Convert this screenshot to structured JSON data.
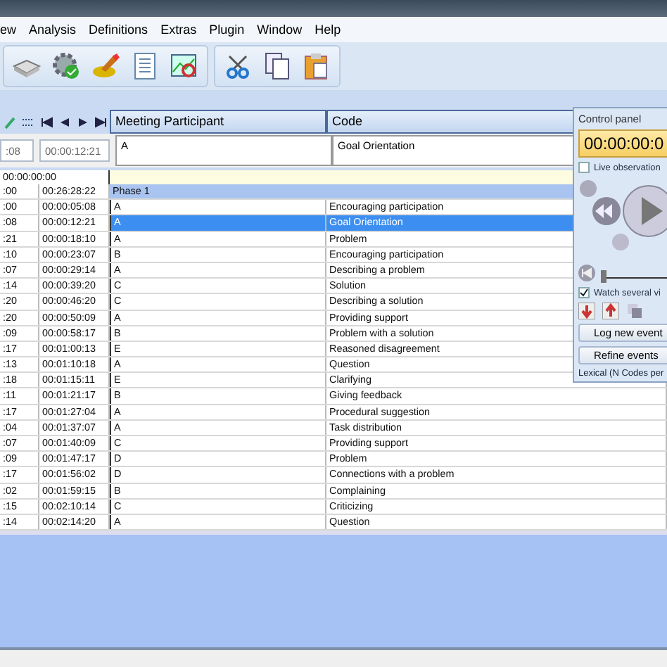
{
  "menu": [
    {
      "label": "ew"
    },
    {
      "label": "Analysis"
    },
    {
      "label": "Definitions"
    },
    {
      "label": "Extras"
    },
    {
      "label": "Plugin"
    },
    {
      "label": "Window"
    },
    {
      "label": "Help"
    }
  ],
  "columns": [
    "Meeting Participant",
    "Code"
  ],
  "editor": {
    "start": ":08",
    "end": "00:00:12:21",
    "participant": "A",
    "code": "Goal Orientation"
  },
  "filter_row": {
    "time": "00:00:00:00"
  },
  "phase": {
    "start": ":00",
    "end": "00:26:28:22",
    "label": "Phase 1"
  },
  "rows": [
    {
      "start": ":00",
      "end": "00:00:05:08",
      "participant": "A",
      "code": "Encouraging participation",
      "selected": false
    },
    {
      "start": ":08",
      "end": "00:00:12:21",
      "participant": "A",
      "code": "Goal Orientation",
      "selected": true
    },
    {
      "start": ":21",
      "end": "00:00:18:10",
      "participant": "A",
      "code": "Problem",
      "selected": false
    },
    {
      "start": ":10",
      "end": "00:00:23:07",
      "participant": "B",
      "code": "Encouraging participation",
      "selected": false
    },
    {
      "start": ":07",
      "end": "00:00:29:14",
      "participant": "A",
      "code": "Describing a problem",
      "selected": false
    },
    {
      "start": ":14",
      "end": "00:00:39:20",
      "participant": "C",
      "code": "Solution",
      "selected": false
    },
    {
      "start": ":20",
      "end": "00:00:46:20",
      "participant": "C",
      "code": "Describing a solution",
      "selected": false
    },
    {
      "start": ":20",
      "end": "00:00:50:09",
      "participant": "A",
      "code": "Providing support",
      "selected": false
    },
    {
      "start": ":09",
      "end": "00:00:58:17",
      "participant": "B",
      "code": "Problem with a solution",
      "selected": false
    },
    {
      "start": ":17",
      "end": "00:01:00:13",
      "participant": "E",
      "code": "Reasoned disagreement",
      "selected": false
    },
    {
      "start": ":13",
      "end": "00:01:10:18",
      "participant": "A",
      "code": "Question",
      "selected": false
    },
    {
      "start": ":18",
      "end": "00:01:15:11",
      "participant": "E",
      "code": "Clarifying",
      "selected": false
    },
    {
      "start": ":11",
      "end": "00:01:21:17",
      "participant": "B",
      "code": "Giving feedback",
      "selected": false
    },
    {
      "start": ":17",
      "end": "00:01:27:04",
      "participant": "A",
      "code": "Procedural suggestion",
      "selected": false
    },
    {
      "start": ":04",
      "end": "00:01:37:07",
      "participant": "A",
      "code": "Task distribution",
      "selected": false
    },
    {
      "start": ":07",
      "end": "00:01:40:09",
      "participant": "C",
      "code": "Providing support",
      "selected": false
    },
    {
      "start": ":09",
      "end": "00:01:47:17",
      "participant": "D",
      "code": "Problem",
      "selected": false
    },
    {
      "start": ":17",
      "end": "00:01:56:02",
      "participant": "D",
      "code": "Connections with a problem",
      "selected": false
    },
    {
      "start": ":02",
      "end": "00:01:59:15",
      "participant": "B",
      "code": "Complaining",
      "selected": false
    },
    {
      "start": ":15",
      "end": "00:02:10:14",
      "participant": "C",
      "code": "Criticizing",
      "selected": false
    },
    {
      "start": ":14",
      "end": "00:02:14:20",
      "participant": "A",
      "code": "Question",
      "selected": false
    }
  ],
  "control_panel": {
    "title": "Control panel",
    "time": "00:00:00:0",
    "live_observation": {
      "label": "Live observation",
      "checked": false
    },
    "position": {
      "level": 0
    },
    "watch_several": {
      "label": "Watch several vi",
      "checked": true
    },
    "buttons": [
      "Log new event",
      "Refine events"
    ],
    "footer": "Lexical (N Codes per"
  }
}
